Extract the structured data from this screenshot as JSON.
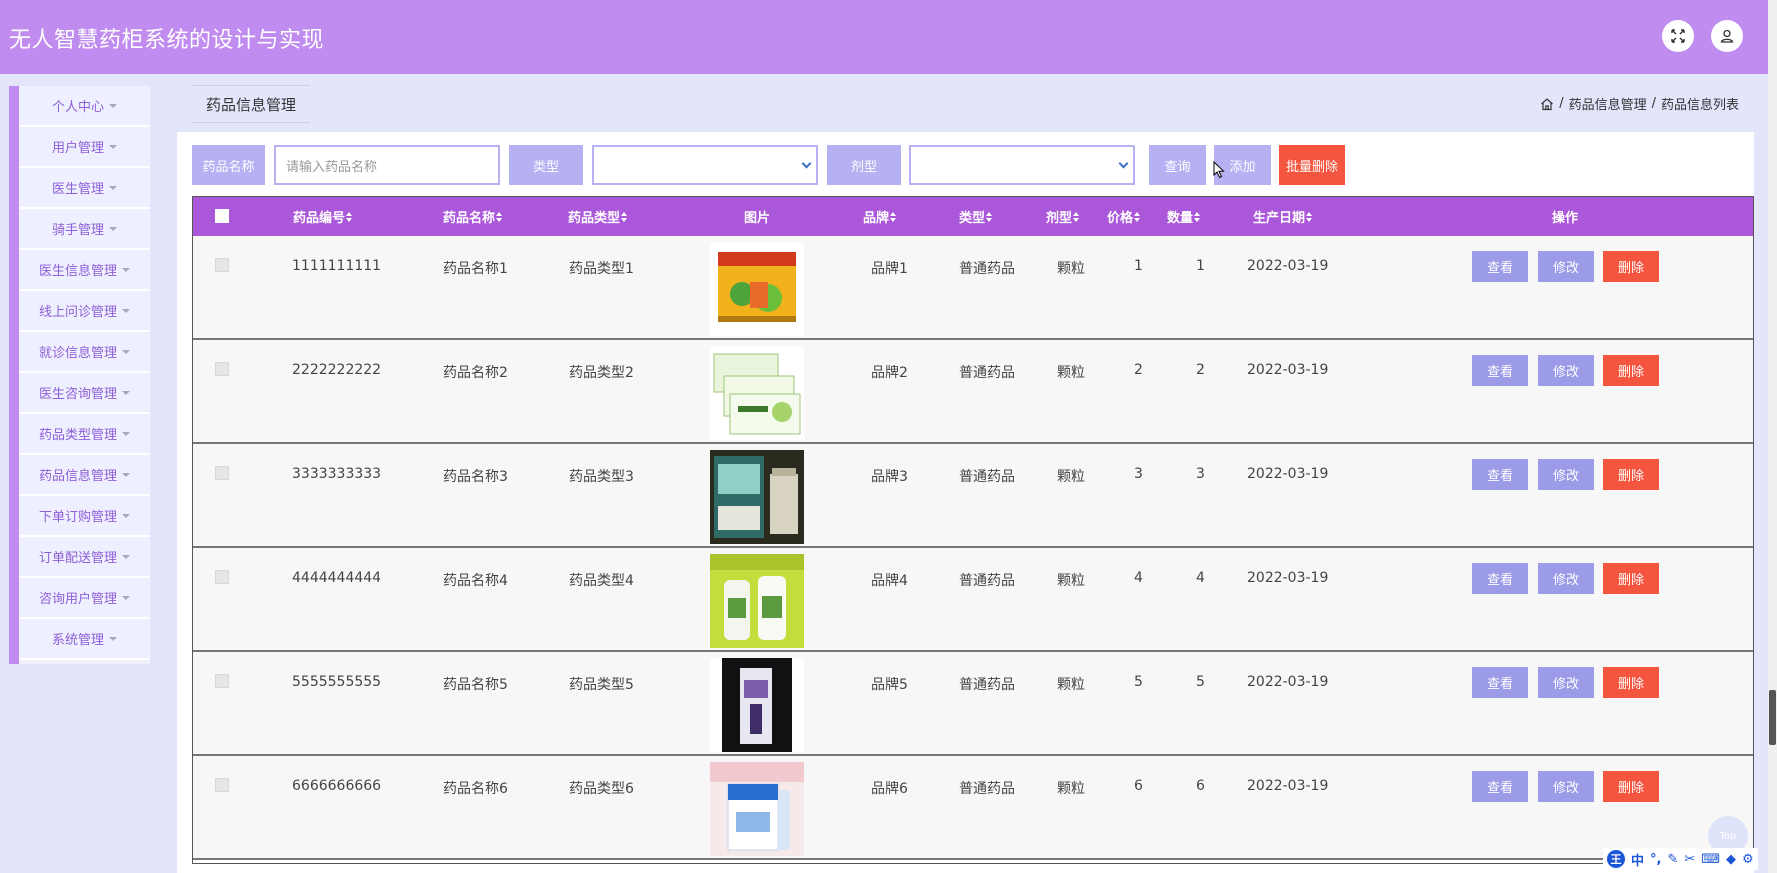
{
  "app": {
    "title": "无人智慧药柜系统的设计与实现"
  },
  "header": {
    "fullscreen_icon": "expand-arrows-icon",
    "user_icon": "user-icon"
  },
  "sidebar": {
    "items": [
      {
        "label": "个人中心"
      },
      {
        "label": "用户管理"
      },
      {
        "label": "医生管理"
      },
      {
        "label": "骑手管理"
      },
      {
        "label": "医生信息管理"
      },
      {
        "label": "线上问诊管理"
      },
      {
        "label": "就诊信息管理"
      },
      {
        "label": "医生咨询管理"
      },
      {
        "label": "药品类型管理"
      },
      {
        "label": "药品信息管理"
      },
      {
        "label": "下单订购管理"
      },
      {
        "label": "订单配送管理"
      },
      {
        "label": "咨询用户管理"
      },
      {
        "label": "系统管理"
      }
    ]
  },
  "tab": {
    "label": "药品信息管理"
  },
  "breadcrumb": {
    "home_icon": "home-icon",
    "level1": "药品信息管理",
    "sep": "/",
    "level2": "药品信息列表"
  },
  "search": {
    "name_label": "药品名称",
    "name_placeholder": "请输入药品名称",
    "name_value": "",
    "type_label": "类型",
    "type_value": "",
    "form_label": "剂型",
    "form_value": "",
    "query_button": "查询",
    "add_button": "添加",
    "batch_delete_button": "批量删除"
  },
  "table": {
    "headers": {
      "code": "药品编号",
      "name": "药品名称",
      "category": "药品类型",
      "image": "图片",
      "brand": "品牌",
      "type": "类型",
      "form": "剂型",
      "price": "价格",
      "qty": "数量",
      "date": "生产日期",
      "ops": "操作"
    },
    "action_labels": {
      "view": "查看",
      "edit": "修改",
      "delete": "删除"
    },
    "rows": [
      {
        "code": "1111111111",
        "name": "药品名称1",
        "category": "药品类型1",
        "brand": "品牌1",
        "type": "普通药品",
        "form": "颗粒",
        "price": "1",
        "qty": "1",
        "date": "2022-03-19"
      },
      {
        "code": "2222222222",
        "name": "药品名称2",
        "category": "药品类型2",
        "brand": "品牌2",
        "type": "普通药品",
        "form": "颗粒",
        "price": "2",
        "qty": "2",
        "date": "2022-03-19"
      },
      {
        "code": "3333333333",
        "name": "药品名称3",
        "category": "药品类型3",
        "brand": "品牌3",
        "type": "普通药品",
        "form": "颗粒",
        "price": "3",
        "qty": "3",
        "date": "2022-03-19"
      },
      {
        "code": "4444444444",
        "name": "药品名称4",
        "category": "药品类型4",
        "brand": "品牌4",
        "type": "普通药品",
        "form": "颗粒",
        "price": "4",
        "qty": "4",
        "date": "2022-03-19"
      },
      {
        "code": "5555555555",
        "name": "药品名称5",
        "category": "药品类型5",
        "brand": "品牌5",
        "type": "普通药品",
        "form": "颗粒",
        "price": "5",
        "qty": "5",
        "date": "2022-03-19"
      },
      {
        "code": "6666666666",
        "name": "药品名称6",
        "category": "药品类型6",
        "brand": "品牌6",
        "type": "普通药品",
        "form": "颗粒",
        "price": "6",
        "qty": "6",
        "date": "2022-03-19"
      }
    ]
  },
  "back_to_top": {
    "label": "Top"
  },
  "ime": {
    "logo": "王",
    "mode": "中"
  },
  "colors": {
    "header": "#c08cf0",
    "table_header": "#ab57d9",
    "label_bg": "#b5b1f2",
    "action_btn": "#9b9be8",
    "delete_btn": "#f4553e",
    "sidebar_text": "#8e5ed7"
  }
}
